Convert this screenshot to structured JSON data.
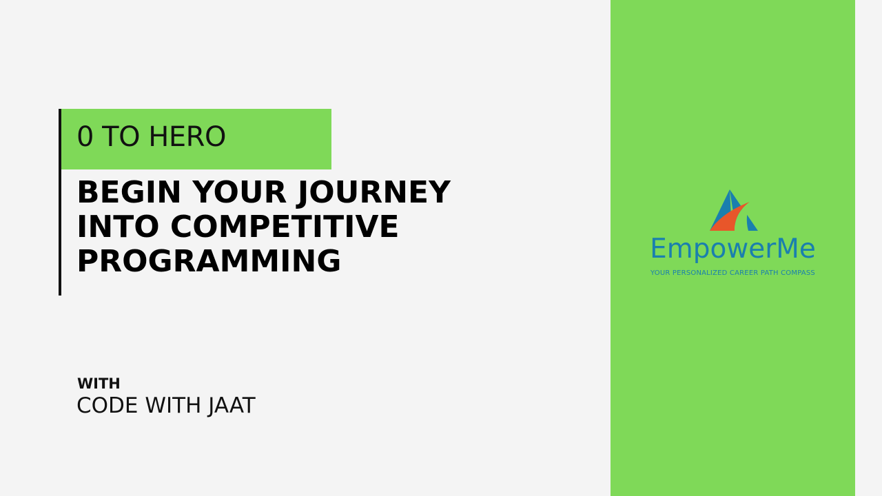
{
  "title_card": {
    "badge": "0 TO HERO",
    "headline_lines": [
      "BEGIN YOUR JOURNEY",
      "INTO COMPETITIVE",
      "PROGRAMMING"
    ],
    "with_label": "WITH",
    "author": "CODE WITH JAAT"
  },
  "logo": {
    "name": "EmpowerMe",
    "tagline": "YOUR PERSONALIZED CAREER PATH COMPASS",
    "icon": "triangle-path-logo-icon"
  },
  "colors": {
    "background": "#f4f4f4",
    "accent_green": "#7fd958",
    "text": "#111111",
    "logo_blue": "#1a7fae",
    "logo_orange": "#e8562a"
  }
}
